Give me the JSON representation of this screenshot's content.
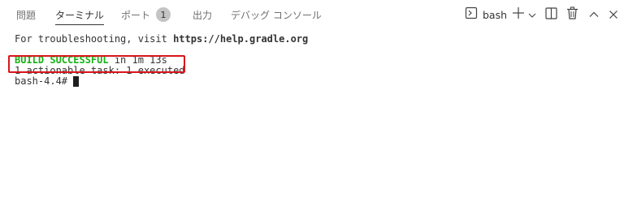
{
  "tabs": {
    "problems": "問題",
    "terminal": "ターミナル",
    "ports": "ポート",
    "ports_badge": "1",
    "output": "出力",
    "debug_console": "デバッグ コンソール"
  },
  "toolbar": {
    "shell_label": "bash",
    "icons": {
      "shell": "terminal-shell-icon",
      "add": "plus-icon",
      "dropdown": "chevron-down-icon",
      "split": "split-panel-icon",
      "trash": "trash-icon",
      "maximize": "chevron-up-icon",
      "close": "close-icon"
    }
  },
  "terminal": {
    "line1_text": "For troubleshooting, visit ",
    "line1_link": "https://help.gradle.org",
    "success_text": "BUILD SUCCESSFUL",
    "success_suffix": " in 1m 13s",
    "tasks_line": "1 actionable task: 1 executed",
    "prompt": "bash-4.4# "
  },
  "colors": {
    "success": "#16b316",
    "highlight": "#d8161b",
    "badge_bg": "#c4c4c4"
  }
}
